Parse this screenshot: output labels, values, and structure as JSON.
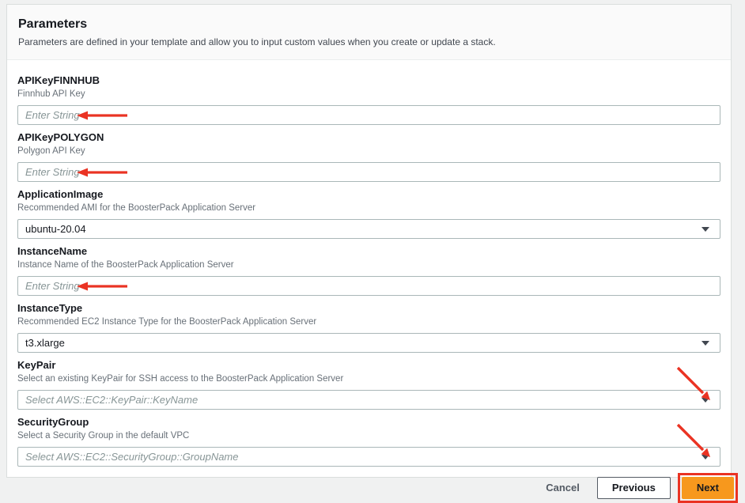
{
  "panel": {
    "title": "Parameters",
    "description": "Parameters are defined in your template and allow you to input custom values when you create or update a stack."
  },
  "fields": [
    {
      "label": "APIKeyFINNHUB",
      "description": "Finnhub API Key",
      "type": "text",
      "placeholder": "Enter String",
      "annotation": "red-left-arrow"
    },
    {
      "label": "APIKeyPOLYGON",
      "description": "Polygon API Key",
      "type": "text",
      "placeholder": "Enter String",
      "annotation": "red-left-arrow"
    },
    {
      "label": "ApplicationImage",
      "description": "Recommended AMI for the BoosterPack Application Server",
      "type": "select",
      "value": "ubuntu-20.04"
    },
    {
      "label": "InstanceName",
      "description": "Instance Name of the BoosterPack Application Server",
      "type": "text",
      "placeholder": "Enter String",
      "annotation": "red-left-arrow"
    },
    {
      "label": "InstanceType",
      "description": "Recommended EC2 Instance Type for the BoosterPack Application Server",
      "type": "select",
      "value": "t3.xlarge"
    },
    {
      "label": "KeyPair",
      "description": "Select an existing KeyPair for SSH access to the BoosterPack Application Server",
      "type": "select",
      "placeholder": "Select AWS::EC2::KeyPair::KeyName",
      "annotation": "red-diagonal-arrow"
    },
    {
      "label": "SecurityGroup",
      "description": "Select a Security Group in the default VPC",
      "type": "select",
      "placeholder": "Select AWS::EC2::SecurityGroup::GroupName",
      "annotation": "red-diagonal-arrow"
    }
  ],
  "footer": {
    "cancel_label": "Cancel",
    "previous_label": "Previous",
    "next_label": "Next"
  },
  "colors": {
    "annotation_red": "#ea3323",
    "primary_orange": "#f7981d",
    "input_border": "#aab7b8",
    "page_background": "#f0f1f1"
  }
}
